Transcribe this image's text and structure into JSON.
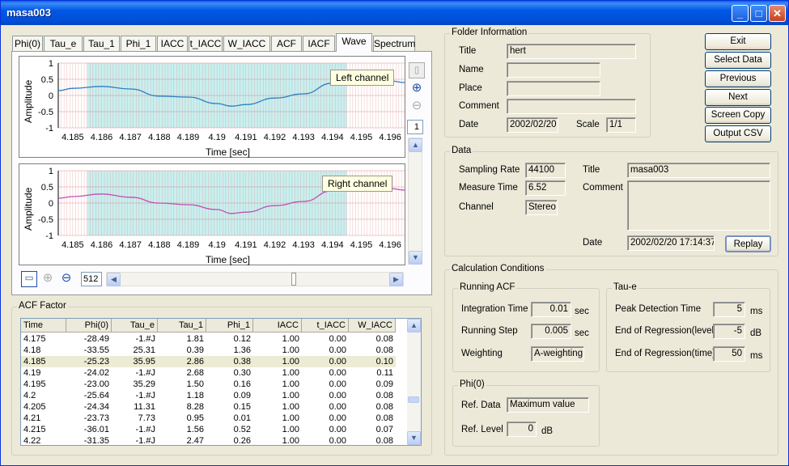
{
  "window": {
    "title": "masa003"
  },
  "tabs": [
    "Phi(0)",
    "Tau_e",
    "Tau_1",
    "Phi_1",
    "IACC",
    "t_IACC",
    "W_IACC",
    "ACF",
    "IACF",
    "Wave",
    "Spectrum"
  ],
  "active_tab": "Wave",
  "wave": {
    "ylabel": "Amplitude",
    "xlabel": "Time [sec]",
    "yticks": [
      "1",
      "0.5",
      "0",
      "-0.5",
      "-1"
    ],
    "xticks": [
      "4.185",
      "4.186",
      "4.187",
      "4.188",
      "4.189",
      "4.19",
      "4.191",
      "4.192",
      "4.193",
      "4.194",
      "4.195",
      "4.196"
    ],
    "left_label": "Left channel",
    "right_label": "Right channel",
    "left_color": "#2a7fc0",
    "right_color": "#c04fb0",
    "highlight_color": "#c8f0f0",
    "page_indicator": "1",
    "zoom_value": "512"
  },
  "chart_data": {
    "type": "line",
    "x": [
      4.1845,
      4.185,
      4.186,
      4.187,
      4.188,
      4.189,
      4.19,
      4.1905,
      4.191,
      4.192,
      4.193,
      4.194,
      4.195,
      4.196,
      4.1965
    ],
    "series": [
      {
        "name": "Left channel",
        "values": [
          0.15,
          0.22,
          0.28,
          0.2,
          -0.02,
          -0.05,
          -0.25,
          -0.33,
          -0.28,
          -0.08,
          0.05,
          0.38,
          0.55,
          0.45,
          0.4
        ]
      },
      {
        "name": "Right channel",
        "values": [
          0.15,
          0.2,
          0.28,
          0.18,
          0.0,
          -0.05,
          -0.2,
          -0.32,
          -0.28,
          -0.08,
          0.05,
          0.38,
          0.55,
          0.45,
          0.4
        ]
      }
    ],
    "xlim": [
      4.1845,
      4.1965
    ],
    "ylim": [
      -1,
      1
    ],
    "highlight_range": [
      4.1855,
      4.1945
    ],
    "grid": true
  },
  "buttons": {
    "exit": "Exit",
    "select_data": "Select Data",
    "previous": "Previous",
    "next": "Next",
    "screen_copy": "Screen Copy",
    "output_csv": "Output CSV",
    "replay": "Replay"
  },
  "folder_info": {
    "legend": "Folder Information",
    "title_label": "Title",
    "title_value": "hert",
    "name_label": "Name",
    "name_value": "",
    "place_label": "Place",
    "place_value": "",
    "comment_label": "Comment",
    "comment_value": "",
    "date_label": "Date",
    "date_value": "2002/02/20",
    "scale_label": "Scale",
    "scale_value": "1/1"
  },
  "data_group": {
    "legend": "Data",
    "sampling_rate_label": "Sampling Rate",
    "sampling_rate": "44100",
    "measure_time_label": "Measure Time",
    "measure_time": "6.52",
    "channel_label": "Channel",
    "channel": "Stereo",
    "title_label": "Title",
    "title_value": "masa003",
    "comment_label": "Comment",
    "comment_value": "",
    "date_label": "Date",
    "date_value": "2002/02/20 17:14:37"
  },
  "calc": {
    "legend": "Calculation Conditions",
    "running_acf": {
      "legend": "Running ACF",
      "integration_time_label": "Integration Time",
      "integration_time": "0.01",
      "integration_unit": "sec",
      "running_step_label": "Running Step",
      "running_step": "0.005",
      "running_step_unit": "sec",
      "weighting_label": "Weighting",
      "weighting": "A-weighting"
    },
    "tau_e": {
      "legend": "Tau-e",
      "peak_label": "Peak Detection Time",
      "peak": "5",
      "peak_unit": "ms",
      "end_level_label": "End of Regression(level)",
      "end_level": "-5",
      "end_level_unit": "dB",
      "end_time_label": "End of Regression(time)",
      "end_time": "50",
      "end_time_unit": "ms"
    },
    "phi0": {
      "legend": "Phi(0)",
      "ref_data_label": "Ref. Data",
      "ref_data": "Maximum value",
      "ref_level_label": "Ref. Level",
      "ref_level": "0",
      "ref_level_unit": "dB"
    }
  },
  "acf_factor": {
    "legend": "ACF Factor",
    "columns": [
      "Time",
      "Phi(0)",
      "Tau_e",
      "Tau_1",
      "Phi_1",
      "IACC",
      "t_IACC",
      "W_IACC"
    ],
    "rows": [
      [
        "4.175",
        "-28.49",
        "-1.#J",
        "1.81",
        "0.12",
        "1.00",
        "0.00",
        "0.08"
      ],
      [
        "4.18",
        "-33.55",
        "25.31",
        "0.39",
        "1.36",
        "1.00",
        "0.00",
        "0.08"
      ],
      [
        "4.185",
        "-25.23",
        "35.95",
        "2.86",
        "0.38",
        "1.00",
        "0.00",
        "0.10"
      ],
      [
        "4.19",
        "-24.02",
        "-1.#J",
        "2.68",
        "0.30",
        "1.00",
        "0.00",
        "0.11"
      ],
      [
        "4.195",
        "-23.00",
        "35.29",
        "1.50",
        "0.16",
        "1.00",
        "0.00",
        "0.09"
      ],
      [
        "4.2",
        "-25.64",
        "-1.#J",
        "1.18",
        "0.09",
        "1.00",
        "0.00",
        "0.08"
      ],
      [
        "4.205",
        "-24.34",
        "11.31",
        "8.28",
        "0.15",
        "1.00",
        "0.00",
        "0.08"
      ],
      [
        "4.21",
        "-23.73",
        "7.73",
        "0.95",
        "0.01",
        "1.00",
        "0.00",
        "0.08"
      ],
      [
        "4.215",
        "-36.01",
        "-1.#J",
        "1.56",
        "0.52",
        "1.00",
        "0.00",
        "0.07"
      ],
      [
        "4.22",
        "-31.35",
        "-1.#J",
        "2.47",
        "0.26",
        "1.00",
        "0.00",
        "0.08"
      ]
    ],
    "selected_row": 2
  }
}
